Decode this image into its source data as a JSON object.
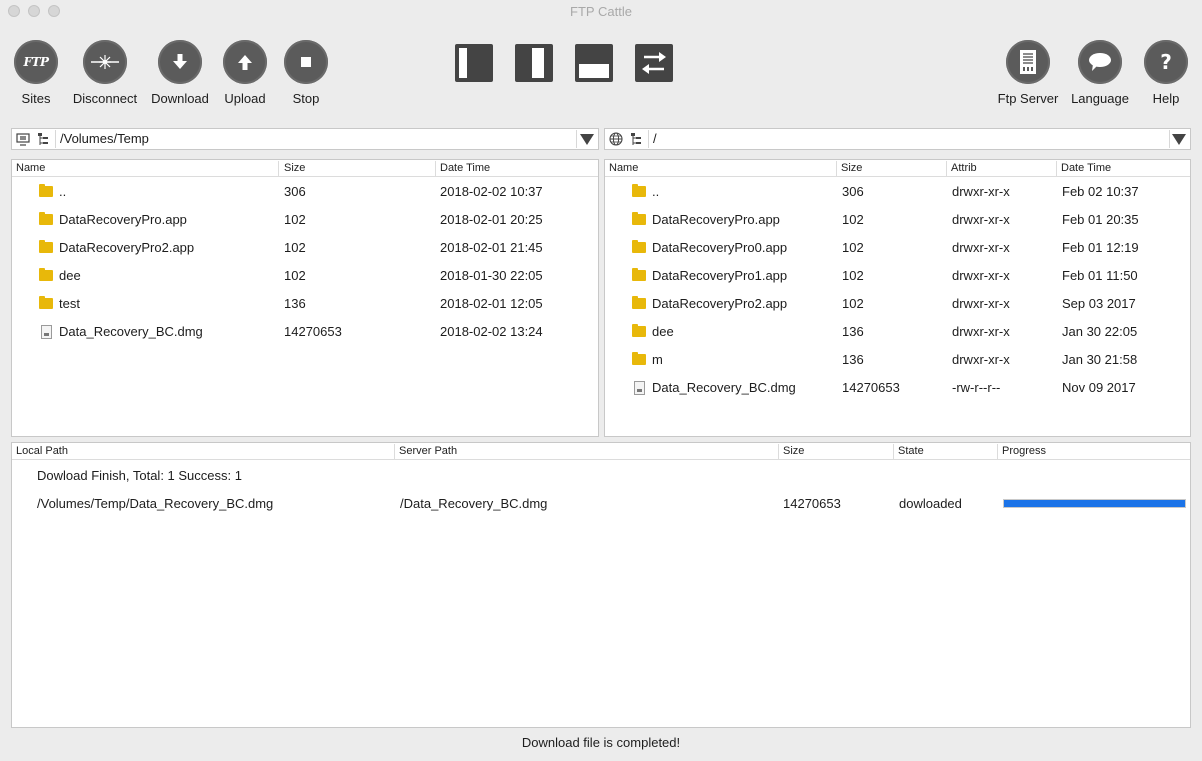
{
  "window": {
    "title": "FTP Cattle"
  },
  "toolbar": {
    "left": [
      {
        "name": "sites-button",
        "icon": "ftp-icon",
        "label": "Sites"
      },
      {
        "name": "disconnect-button",
        "icon": "spark-icon",
        "label": "Disconnect"
      },
      {
        "name": "download-button",
        "icon": "arrow-down-icon",
        "label": "Download"
      },
      {
        "name": "upload-button",
        "icon": "arrow-up-icon",
        "label": "Upload"
      },
      {
        "name": "stop-button",
        "icon": "stop-icon",
        "label": "Stop"
      }
    ],
    "ftp_icon_text": "FTP",
    "layouts": [
      "left-pane-icon",
      "right-pane-icon",
      "bottom-pane-icon",
      "swap-icon"
    ],
    "right": [
      {
        "name": "ftp-server-button",
        "icon": "server-icon",
        "label": "Ftp Server"
      },
      {
        "name": "language-button",
        "icon": "speech-bubble-icon",
        "label": "Language"
      },
      {
        "name": "help-button",
        "icon": "question-icon",
        "label": "Help",
        "glyph": "?"
      }
    ]
  },
  "local": {
    "path": "/Volumes/Temp",
    "columns": [
      "Name",
      "Size",
      "Date Time"
    ],
    "rows": [
      {
        "type": "folder",
        "name": "..",
        "size": "306",
        "date": "2018-02-02 10:37"
      },
      {
        "type": "folder",
        "name": "DataRecoveryPro.app",
        "size": "102",
        "date": "2018-02-01 20:25"
      },
      {
        "type": "folder",
        "name": "DataRecoveryPro2.app",
        "size": "102",
        "date": "2018-02-01 21:45"
      },
      {
        "type": "folder",
        "name": "dee",
        "size": "102",
        "date": "2018-01-30 22:05"
      },
      {
        "type": "folder",
        "name": "test",
        "size": "136",
        "date": "2018-02-01 12:05"
      },
      {
        "type": "file",
        "name": "Data_Recovery_BC.dmg",
        "size": "14270653",
        "date": "2018-02-02 13:24"
      }
    ]
  },
  "remote": {
    "path": "/",
    "columns": [
      "Name",
      "Size",
      "Attrib",
      "Date Time"
    ],
    "rows": [
      {
        "type": "folder",
        "name": "..",
        "size": "306",
        "attrib": "drwxr-xr-x",
        "date": "Feb 02 10:37"
      },
      {
        "type": "folder",
        "name": "DataRecoveryPro.app",
        "size": "102",
        "attrib": "drwxr-xr-x",
        "date": "Feb 01 20:35"
      },
      {
        "type": "folder",
        "name": "DataRecoveryPro0.app",
        "size": "102",
        "attrib": "drwxr-xr-x",
        "date": "Feb 01 12:19"
      },
      {
        "type": "folder",
        "name": "DataRecoveryPro1.app",
        "size": "102",
        "attrib": "drwxr-xr-x",
        "date": "Feb 01 11:50"
      },
      {
        "type": "folder",
        "name": "DataRecoveryPro2.app",
        "size": "102",
        "attrib": "drwxr-xr-x",
        "date": "Sep 03 2017"
      },
      {
        "type": "folder",
        "name": "dee",
        "size": "136",
        "attrib": "drwxr-xr-x",
        "date": "Jan 30 22:05"
      },
      {
        "type": "folder",
        "name": "m",
        "size": "136",
        "attrib": "drwxr-xr-x",
        "date": "Jan 30 21:58"
      },
      {
        "type": "file",
        "name": "Data_Recovery_BC.dmg",
        "size": "14270653",
        "attrib": "-rw-r--r--",
        "date": "Nov 09 2017"
      }
    ]
  },
  "transfers": {
    "columns": [
      "Local Path",
      "Server Path",
      "Size",
      "State",
      "Progress"
    ],
    "summary": "Dowload Finish, Total: 1 Success: 1",
    "items": [
      {
        "local": "/Volumes/Temp/Data_Recovery_BC.dmg",
        "server": "/Data_Recovery_BC.dmg",
        "size": "14270653",
        "state": "dowloaded",
        "progress": 1.0
      }
    ]
  },
  "status": "Download file is completed!",
  "colors": {
    "accent": "#1b73e8",
    "folder": "#e8b80a",
    "toolbar_icon": "#5b5b5b"
  }
}
